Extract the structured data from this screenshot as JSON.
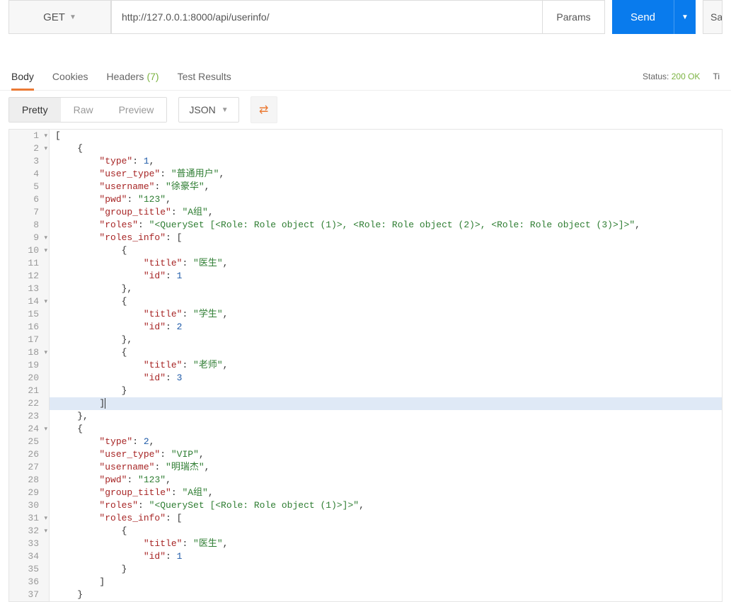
{
  "request": {
    "method": "GET",
    "url": "http://127.0.0.1:8000/api/userinfo/",
    "params_label": "Params",
    "send_label": "Send",
    "save_label": "Sa"
  },
  "tabs": {
    "body": "Body",
    "cookies": "Cookies",
    "headers": "Headers",
    "headers_count": "(7)",
    "test_results": "Test Results"
  },
  "status": {
    "label": "Status:",
    "value": "200 OK",
    "time_label": "Ti"
  },
  "view": {
    "pretty": "Pretty",
    "raw": "Raw",
    "preview": "Preview",
    "format": "JSON"
  },
  "lines": [
    {
      "num": "1",
      "fold": "▾",
      "hl": false,
      "tokens": [
        [
          "p",
          "["
        ]
      ]
    },
    {
      "num": "2",
      "fold": "▾",
      "hl": false,
      "tokens": [
        [
          "p",
          "    {"
        ]
      ]
    },
    {
      "num": "3",
      "fold": "",
      "hl": false,
      "tokens": [
        [
          "p",
          "        "
        ],
        [
          "k",
          "\"type\""
        ],
        [
          "p",
          ": "
        ],
        [
          "n",
          "1"
        ],
        [
          "p",
          ","
        ]
      ]
    },
    {
      "num": "4",
      "fold": "",
      "hl": false,
      "tokens": [
        [
          "p",
          "        "
        ],
        [
          "k",
          "\"user_type\""
        ],
        [
          "p",
          ": "
        ],
        [
          "s",
          "\"普通用户\""
        ],
        [
          "p",
          ","
        ]
      ]
    },
    {
      "num": "5",
      "fold": "",
      "hl": false,
      "tokens": [
        [
          "p",
          "        "
        ],
        [
          "k",
          "\"username\""
        ],
        [
          "p",
          ": "
        ],
        [
          "s",
          "\"徐豪华\""
        ],
        [
          "p",
          ","
        ]
      ]
    },
    {
      "num": "6",
      "fold": "",
      "hl": false,
      "tokens": [
        [
          "p",
          "        "
        ],
        [
          "k",
          "\"pwd\""
        ],
        [
          "p",
          ": "
        ],
        [
          "s",
          "\"123\""
        ],
        [
          "p",
          ","
        ]
      ]
    },
    {
      "num": "7",
      "fold": "",
      "hl": false,
      "tokens": [
        [
          "p",
          "        "
        ],
        [
          "k",
          "\"group_title\""
        ],
        [
          "p",
          ": "
        ],
        [
          "s",
          "\"A组\""
        ],
        [
          "p",
          ","
        ]
      ]
    },
    {
      "num": "8",
      "fold": "",
      "hl": false,
      "tokens": [
        [
          "p",
          "        "
        ],
        [
          "k",
          "\"roles\""
        ],
        [
          "p",
          ": "
        ],
        [
          "s",
          "\"<QuerySet [<Role: Role object (1)>, <Role: Role object (2)>, <Role: Role object (3)>]>\""
        ],
        [
          "p",
          ","
        ]
      ]
    },
    {
      "num": "9",
      "fold": "▾",
      "hl": false,
      "tokens": [
        [
          "p",
          "        "
        ],
        [
          "k",
          "\"roles_info\""
        ],
        [
          "p",
          ": ["
        ]
      ]
    },
    {
      "num": "10",
      "fold": "▾",
      "hl": false,
      "tokens": [
        [
          "p",
          "            {"
        ]
      ]
    },
    {
      "num": "11",
      "fold": "",
      "hl": false,
      "tokens": [
        [
          "p",
          "                "
        ],
        [
          "k",
          "\"title\""
        ],
        [
          "p",
          ": "
        ],
        [
          "s",
          "\"医生\""
        ],
        [
          "p",
          ","
        ]
      ]
    },
    {
      "num": "12",
      "fold": "",
      "hl": false,
      "tokens": [
        [
          "p",
          "                "
        ],
        [
          "k",
          "\"id\""
        ],
        [
          "p",
          ": "
        ],
        [
          "n",
          "1"
        ]
      ]
    },
    {
      "num": "13",
      "fold": "",
      "hl": false,
      "tokens": [
        [
          "p",
          "            },"
        ]
      ]
    },
    {
      "num": "14",
      "fold": "▾",
      "hl": false,
      "tokens": [
        [
          "p",
          "            {"
        ]
      ]
    },
    {
      "num": "15",
      "fold": "",
      "hl": false,
      "tokens": [
        [
          "p",
          "                "
        ],
        [
          "k",
          "\"title\""
        ],
        [
          "p",
          ": "
        ],
        [
          "s",
          "\"学生\""
        ],
        [
          "p",
          ","
        ]
      ]
    },
    {
      "num": "16",
      "fold": "",
      "hl": false,
      "tokens": [
        [
          "p",
          "                "
        ],
        [
          "k",
          "\"id\""
        ],
        [
          "p",
          ": "
        ],
        [
          "n",
          "2"
        ]
      ]
    },
    {
      "num": "17",
      "fold": "",
      "hl": false,
      "tokens": [
        [
          "p",
          "            },"
        ]
      ]
    },
    {
      "num": "18",
      "fold": "▾",
      "hl": false,
      "tokens": [
        [
          "p",
          "            {"
        ]
      ]
    },
    {
      "num": "19",
      "fold": "",
      "hl": false,
      "tokens": [
        [
          "p",
          "                "
        ],
        [
          "k",
          "\"title\""
        ],
        [
          "p",
          ": "
        ],
        [
          "s",
          "\"老师\""
        ],
        [
          "p",
          ","
        ]
      ]
    },
    {
      "num": "20",
      "fold": "",
      "hl": false,
      "tokens": [
        [
          "p",
          "                "
        ],
        [
          "k",
          "\"id\""
        ],
        [
          "p",
          ": "
        ],
        [
          "n",
          "3"
        ]
      ]
    },
    {
      "num": "21",
      "fold": "",
      "hl": false,
      "tokens": [
        [
          "p",
          "            }"
        ]
      ]
    },
    {
      "num": "22",
      "fold": "",
      "hl": true,
      "tokens": [
        [
          "p",
          "        ]"
        ]
      ],
      "cursor": true
    },
    {
      "num": "23",
      "fold": "",
      "hl": false,
      "tokens": [
        [
          "p",
          "    },"
        ]
      ]
    },
    {
      "num": "24",
      "fold": "▾",
      "hl": false,
      "tokens": [
        [
          "p",
          "    {"
        ]
      ]
    },
    {
      "num": "25",
      "fold": "",
      "hl": false,
      "tokens": [
        [
          "p",
          "        "
        ],
        [
          "k",
          "\"type\""
        ],
        [
          "p",
          ": "
        ],
        [
          "n",
          "2"
        ],
        [
          "p",
          ","
        ]
      ]
    },
    {
      "num": "26",
      "fold": "",
      "hl": false,
      "tokens": [
        [
          "p",
          "        "
        ],
        [
          "k",
          "\"user_type\""
        ],
        [
          "p",
          ": "
        ],
        [
          "s",
          "\"VIP\""
        ],
        [
          "p",
          ","
        ]
      ]
    },
    {
      "num": "27",
      "fold": "",
      "hl": false,
      "tokens": [
        [
          "p",
          "        "
        ],
        [
          "k",
          "\"username\""
        ],
        [
          "p",
          ": "
        ],
        [
          "s",
          "\"明瑞杰\""
        ],
        [
          "p",
          ","
        ]
      ]
    },
    {
      "num": "28",
      "fold": "",
      "hl": false,
      "tokens": [
        [
          "p",
          "        "
        ],
        [
          "k",
          "\"pwd\""
        ],
        [
          "p",
          ": "
        ],
        [
          "s",
          "\"123\""
        ],
        [
          "p",
          ","
        ]
      ]
    },
    {
      "num": "29",
      "fold": "",
      "hl": false,
      "tokens": [
        [
          "p",
          "        "
        ],
        [
          "k",
          "\"group_title\""
        ],
        [
          "p",
          ": "
        ],
        [
          "s",
          "\"A组\""
        ],
        [
          "p",
          ","
        ]
      ]
    },
    {
      "num": "30",
      "fold": "",
      "hl": false,
      "tokens": [
        [
          "p",
          "        "
        ],
        [
          "k",
          "\"roles\""
        ],
        [
          "p",
          ": "
        ],
        [
          "s",
          "\"<QuerySet [<Role: Role object (1)>]>\""
        ],
        [
          "p",
          ","
        ]
      ]
    },
    {
      "num": "31",
      "fold": "▾",
      "hl": false,
      "tokens": [
        [
          "p",
          "        "
        ],
        [
          "k",
          "\"roles_info\""
        ],
        [
          "p",
          ": ["
        ]
      ]
    },
    {
      "num": "32",
      "fold": "▾",
      "hl": false,
      "tokens": [
        [
          "p",
          "            {"
        ]
      ]
    },
    {
      "num": "33",
      "fold": "",
      "hl": false,
      "tokens": [
        [
          "p",
          "                "
        ],
        [
          "k",
          "\"title\""
        ],
        [
          "p",
          ": "
        ],
        [
          "s",
          "\"医生\""
        ],
        [
          "p",
          ","
        ]
      ]
    },
    {
      "num": "34",
      "fold": "",
      "hl": false,
      "tokens": [
        [
          "p",
          "                "
        ],
        [
          "k",
          "\"id\""
        ],
        [
          "p",
          ": "
        ],
        [
          "n",
          "1"
        ]
      ]
    },
    {
      "num": "35",
      "fold": "",
      "hl": false,
      "tokens": [
        [
          "p",
          "            }"
        ]
      ]
    },
    {
      "num": "36",
      "fold": "",
      "hl": false,
      "tokens": [
        [
          "p",
          "        ]"
        ]
      ]
    },
    {
      "num": "37",
      "fold": "",
      "hl": false,
      "tokens": [
        [
          "p",
          "    }"
        ]
      ]
    }
  ]
}
